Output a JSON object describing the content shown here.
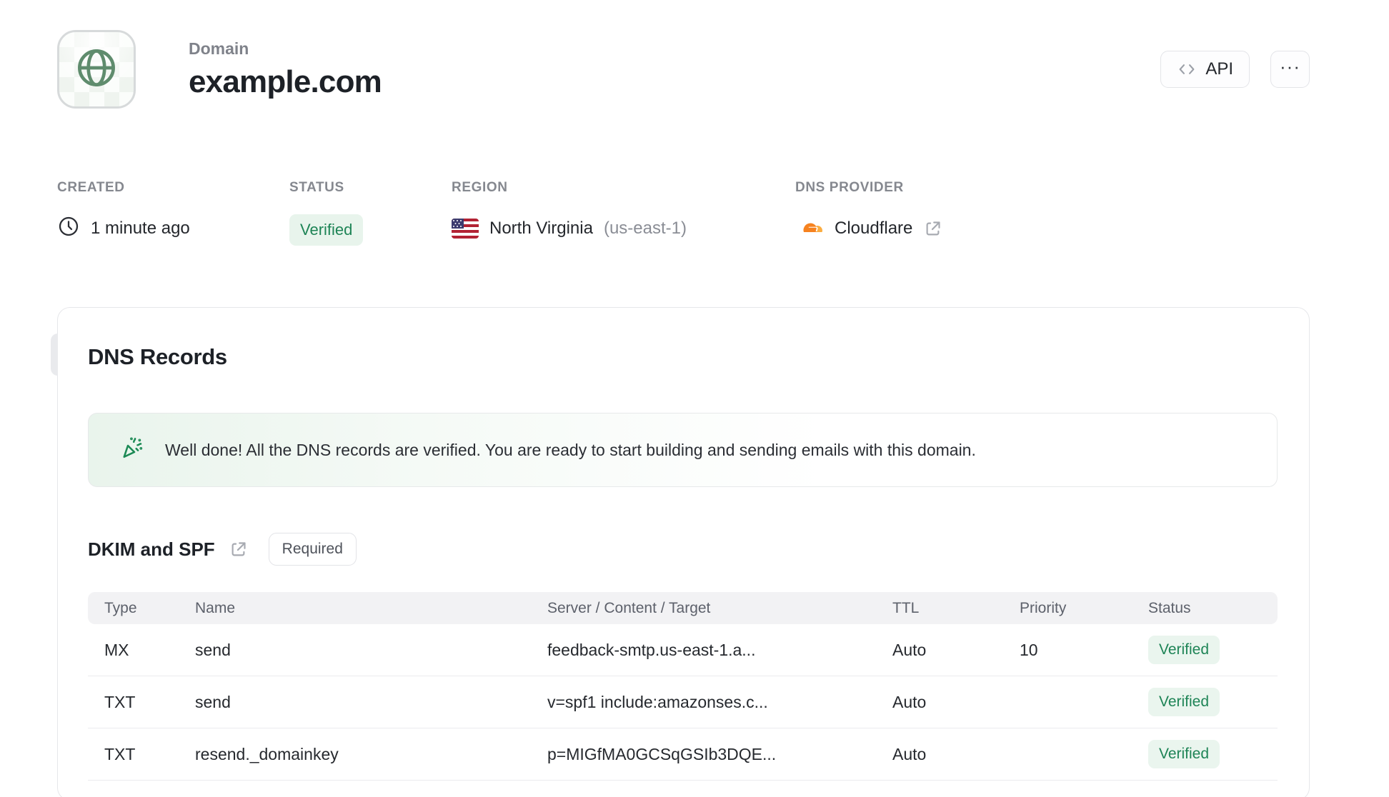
{
  "header": {
    "label": "Domain",
    "title": "example.com",
    "api_button_label": "API",
    "more_button_label": "···"
  },
  "meta": {
    "created": {
      "label": "CREATED",
      "value": "1 minute ago"
    },
    "status": {
      "label": "STATUS",
      "value": "Verified"
    },
    "region": {
      "label": "REGION",
      "value": "North Virginia",
      "code": "(us-east-1)"
    },
    "dns_provider": {
      "label": "DNS PROVIDER",
      "value": "Cloudflare"
    }
  },
  "dns_records": {
    "title": "DNS Records",
    "banner_text": "Well done! All the DNS records are verified. You are ready to start building and sending emails with this domain.",
    "section_title": "DKIM and SPF",
    "section_badge": "Required",
    "table": {
      "headers": [
        "Type",
        "Name",
        "Server / Content / Target",
        "TTL",
        "Priority",
        "Status"
      ],
      "rows": [
        {
          "type": "MX",
          "name": "send",
          "content": "feedback-smtp.us-east-1.a...",
          "ttl": "Auto",
          "priority": "10",
          "status": "Verified"
        },
        {
          "type": "TXT",
          "name": "send",
          "content": "v=spf1 include:amazonses.c...",
          "ttl": "Auto",
          "priority": "",
          "status": "Verified"
        },
        {
          "type": "TXT",
          "name": "resend._domainkey",
          "content": "p=MIGfMA0GCSqGSIb3DQE...",
          "ttl": "Auto",
          "priority": "",
          "status": "Verified"
        }
      ]
    }
  },
  "icons": {
    "avatar": "globe-icon",
    "created": "clock-icon",
    "region": "us-flag-icon",
    "provider": "cloudflare-icon",
    "banner": "party-popper-icon",
    "links": "external-link-icon"
  },
  "colors": {
    "accent_green": "#1e8456",
    "badge_green_bg": "#e8f4ec",
    "globe_green": "#5f8c6d",
    "cloudflare_orange": "#f6821f",
    "cloudflare_orange_light": "#fbad41",
    "card_border": "#e6e7ea",
    "table_header_bg": "#f2f2f4",
    "muted_label": "#85888f"
  }
}
